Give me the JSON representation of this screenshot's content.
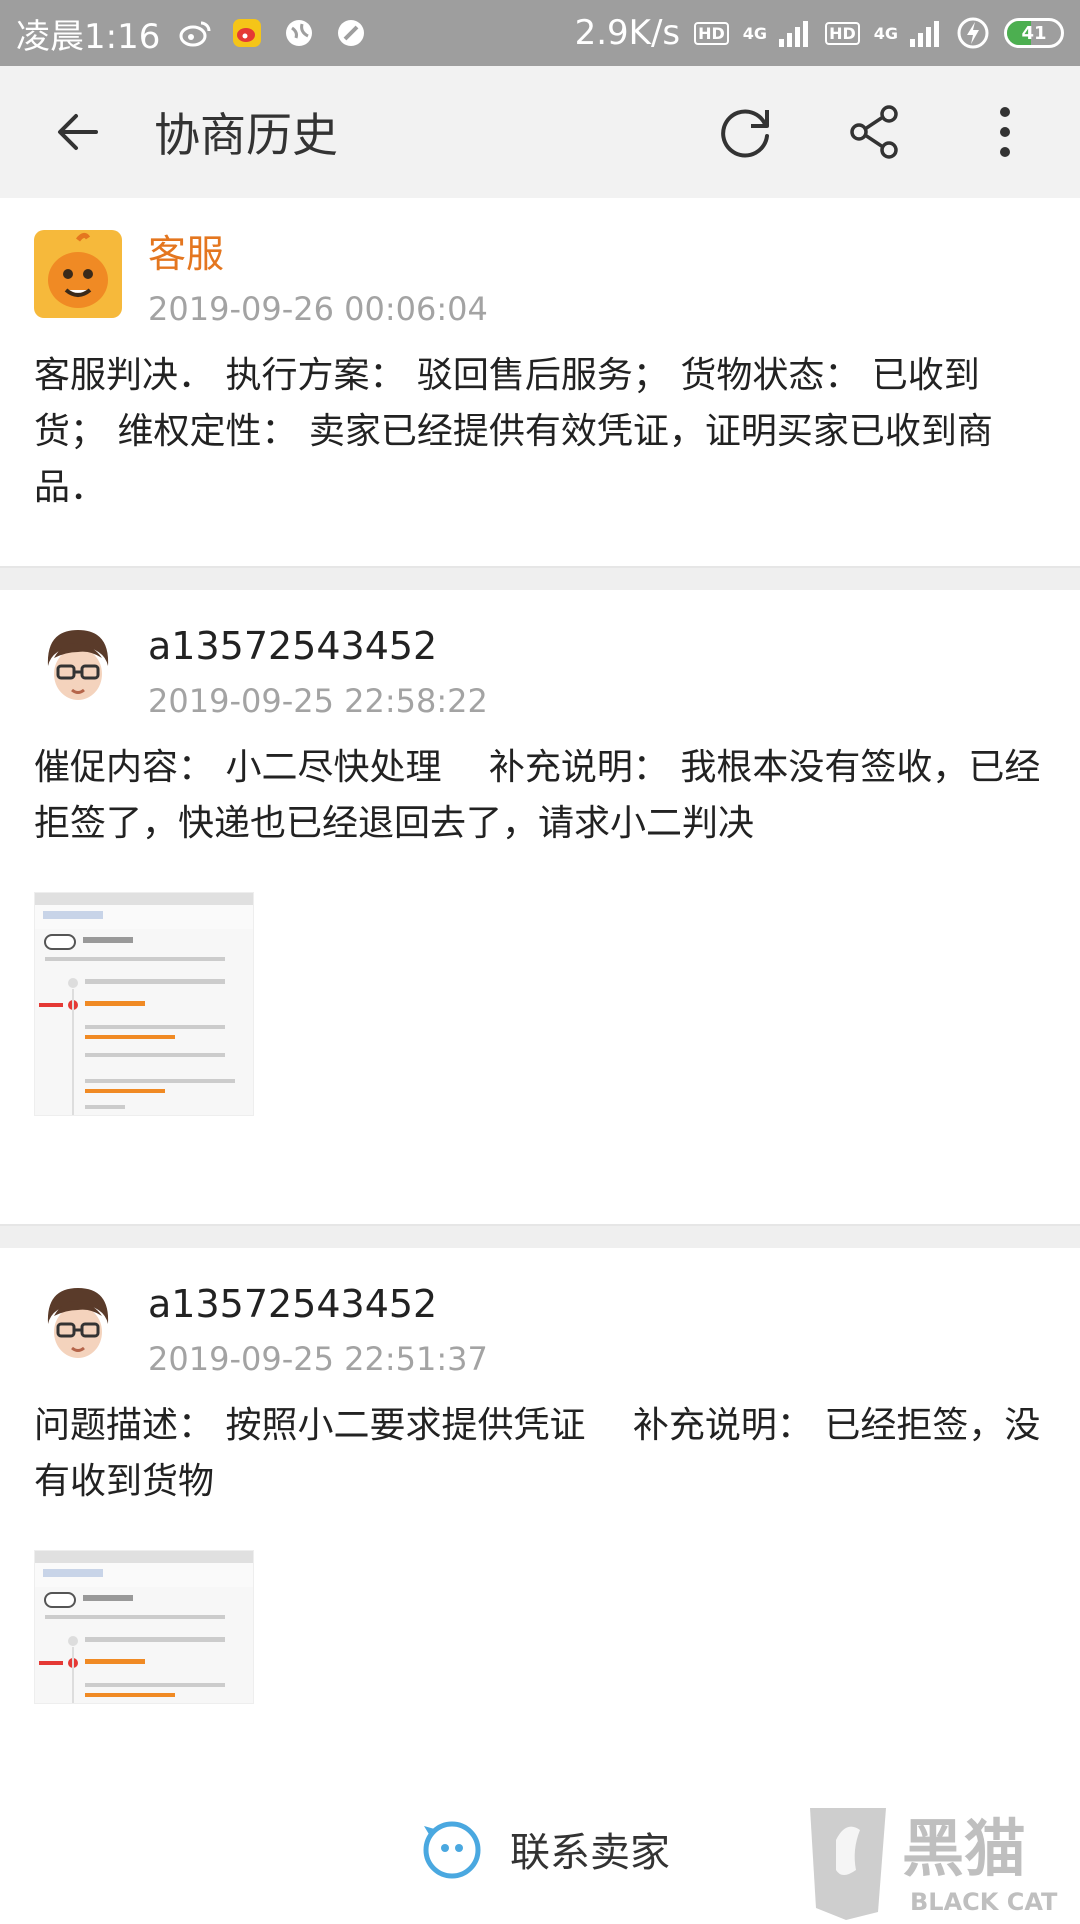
{
  "status_bar": {
    "time": "凌晨1:16",
    "speed": "2.9K/s",
    "hd1": "HD",
    "net1": "4G",
    "hd2": "HD",
    "net2": "4G",
    "battery": "41",
    "icons": [
      "weibo-icon",
      "weibo-app-icon",
      "globe-icon",
      "blocked-icon",
      "signal-icon",
      "charging-icon",
      "battery-icon"
    ]
  },
  "app_bar": {
    "title": "协商历史",
    "icons": [
      "back-arrow-icon",
      "refresh-icon",
      "share-icon",
      "more-vertical-icon"
    ]
  },
  "entries": [
    {
      "author": "客服",
      "time": "2019-09-26 00:06:04",
      "text": "客服判决． 执行方案： 驳回售后服务； 货物状态： 已收到货； 维权定性： 卖家已经提供有效凭证，证明买家已收到商品．"
    },
    {
      "author": "a13572543452",
      "time": "2019-09-25 22:58:22",
      "text": "催促内容： 小二尽快处理　 补充说明： 我根本没有签收，已经拒签了，快递也已经退回去了，请求小二判决"
    },
    {
      "author": "a13572543452",
      "time": "2019-09-25 22:51:37",
      "text": "问题描述： 按照小二要求提供凭证　 补充说明： 已经拒签，没有收到货物"
    }
  ],
  "bottom": {
    "contact_label": "联系卖家"
  },
  "watermark": {
    "cn": "黑猫",
    "en": "BLACK CAT"
  },
  "colors": {
    "status_bar": "#9e9e9e",
    "app_bar": "#f2f2f2",
    "cs_name": "#e4761f",
    "timestamp": "#a3a3a3",
    "contact_icon": "#4aa8e0"
  }
}
